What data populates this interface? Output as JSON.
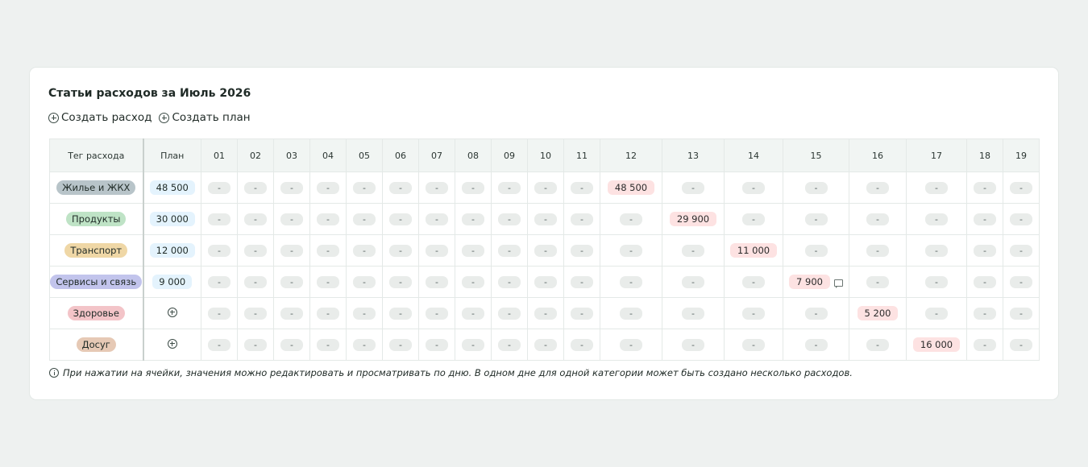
{
  "title": "Статьи расходов за Июль 2026",
  "actions": {
    "create_expense": "Создать расход",
    "create_plan": "Создать план"
  },
  "table": {
    "tag_header": "Тег расхода",
    "plan_header": "План",
    "days": [
      "01",
      "02",
      "03",
      "04",
      "05",
      "06",
      "07",
      "08",
      "09",
      "10",
      "11",
      "12",
      "13",
      "14",
      "15",
      "16",
      "17",
      "18",
      "19"
    ],
    "empty_cell": "-",
    "rows": [
      {
        "tag": "Жилье и ЖКХ",
        "color": "#b8c4c9",
        "plan": "48 500",
        "values": {
          "12": "48 500"
        }
      },
      {
        "tag": "Продукты",
        "color": "#bfe3c6",
        "plan": "30 000",
        "values": {
          "13": "29 900"
        }
      },
      {
        "tag": "Транспорт",
        "color": "#efd7a6",
        "plan": "12 000",
        "values": {
          "14": "11 000"
        }
      },
      {
        "tag": "Сервисы и связь",
        "color": "#c2c4ec",
        "plan": "9 000",
        "values": {
          "15": "7 900"
        },
        "comment_day": "15"
      },
      {
        "tag": "Здоровье",
        "color": "#f3c4c8",
        "plan": "",
        "values": {
          "16": "5 200"
        }
      },
      {
        "tag": "Досуг",
        "color": "#e6c9b5",
        "plan": "",
        "values": {
          "17": "16 000"
        }
      }
    ]
  },
  "note": "При нажатии на ячейки, значения можно редактировать и просматривать по дню. В одном дне для одной категории может быть создано несколько расходов.",
  "icons": {
    "add": "plus-circle-icon",
    "info": "info-icon",
    "comment": "comment-icon"
  }
}
